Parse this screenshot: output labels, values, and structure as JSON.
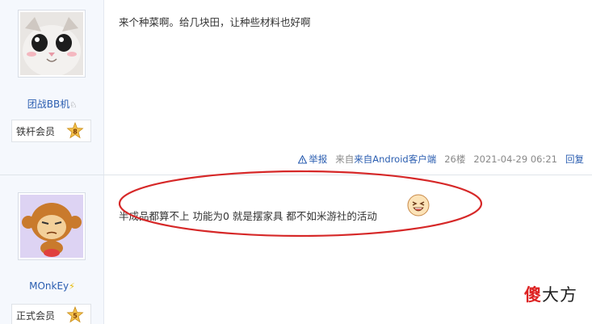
{
  "posts": [
    {
      "username": "团战BB机",
      "rank": "铁杆会员",
      "level": "8",
      "content": "来个种菜啊。给几块田，让种些材料也好啊",
      "report": "举报",
      "source": "来自Android客户端",
      "floor": "26楼",
      "datetime": "2021-04-29 06:21",
      "reply": "回复"
    },
    {
      "username": "MOnkEy",
      "rank": "正式会员",
      "level": "5",
      "content": "半成品都算不上 功能为0 就是摆家具 都不如米游社的活动"
    }
  ],
  "watermark": {
    "first": "傻",
    "rest": "大方"
  },
  "colors": {
    "link": "#2a5db0",
    "annotation_ellipse": "#d62828",
    "sidebar_bg": "#f5f8fd"
  }
}
